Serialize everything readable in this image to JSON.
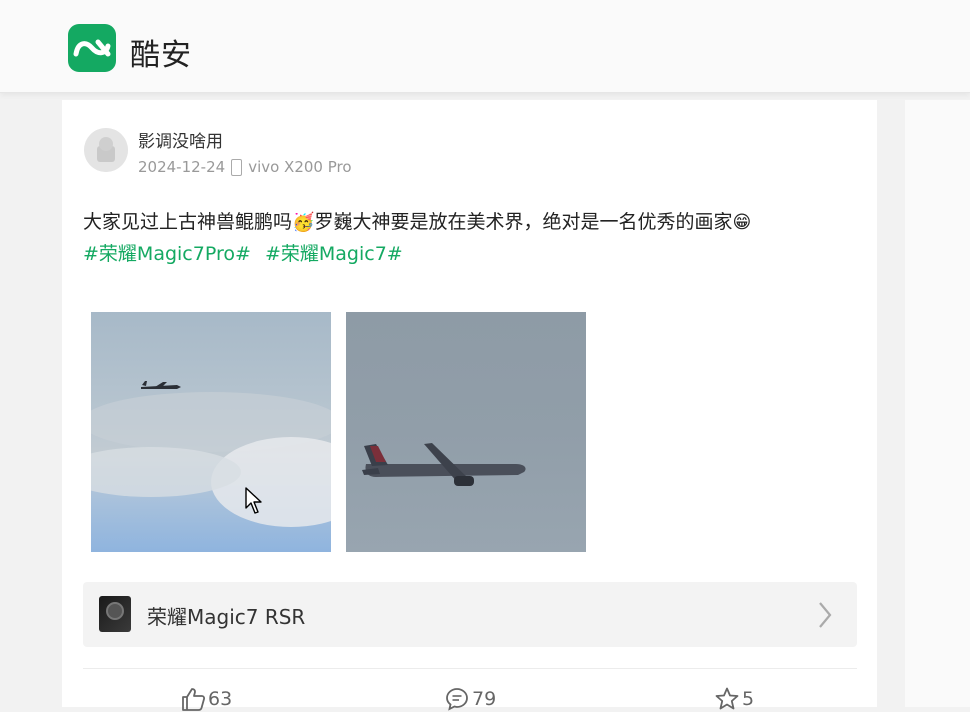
{
  "header": {
    "app_name": "酷安",
    "logo_icon": "coolapk-logo-icon",
    "accent": "#14a962"
  },
  "post": {
    "author": "影调没啥用",
    "date": "2024-12-24",
    "device": "vivo X200 Pro",
    "text_part1": "大家见过上古神兽鲲鹏吗",
    "emoji1": "🥳",
    "text_part2": "罗巍大神要是放在美术界，绝对是一名优秀的画家",
    "emoji2": "😁",
    "tags": [
      "#荣耀Magic7Pro#",
      "#荣耀Magic7#"
    ]
  },
  "product": {
    "name": "荣耀Magic7 RSR"
  },
  "actions": {
    "likes": "63",
    "comments": "79",
    "favorites": "5"
  }
}
